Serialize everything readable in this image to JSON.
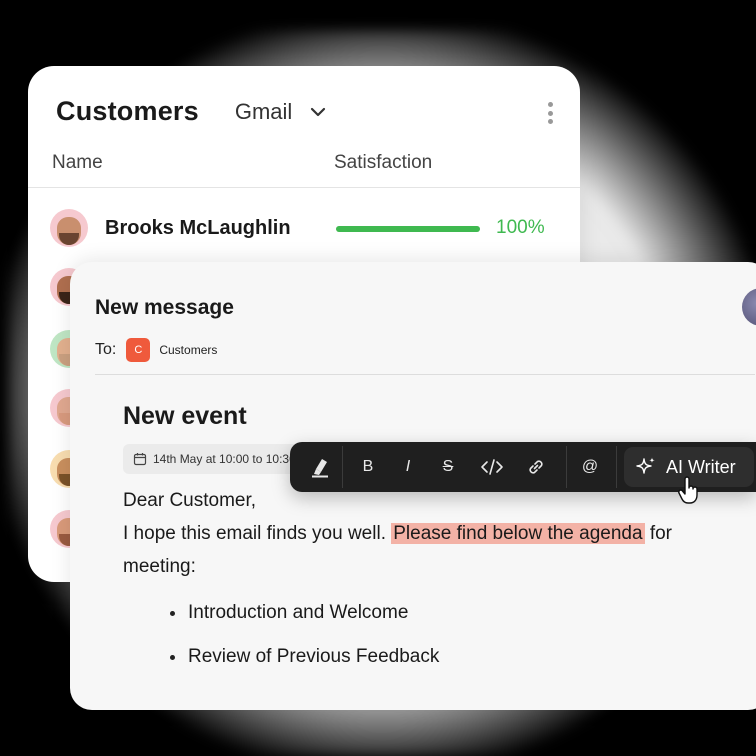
{
  "customers": {
    "title": "Customers",
    "account": "Gmail",
    "columns": {
      "name": "Name",
      "satisfaction": "Satisfaction"
    },
    "rows": [
      {
        "name": "Brooks McLaughlin",
        "satisfaction_percent": 100,
        "satisfaction_label": "100%"
      }
    ]
  },
  "message": {
    "title": "New message",
    "to_label": "To:",
    "recipient_initial": "C",
    "recipient": "Customers",
    "event_title": "New event",
    "date_text": "14th May at 10:00 to 10:30",
    "greeting": "Dear Customer,",
    "line1_plain": "I hope this email finds you well. ",
    "line1_highlight": "Please find below the agenda",
    "line1_tail": " for",
    "line2": "meeting:",
    "bullets": [
      "Introduction and Welcome",
      "Review of Previous Feedback"
    ]
  },
  "toolbar": {
    "bold": "B",
    "italic": "I",
    "strike": "S",
    "mention": "@",
    "ai_writer": "AI Writer"
  },
  "colors": {
    "accent_green": "#3fb950",
    "chip_orange": "#ef5a3c",
    "highlight": "#f3b2a6",
    "toolbar_bg": "#1f1f1f"
  }
}
